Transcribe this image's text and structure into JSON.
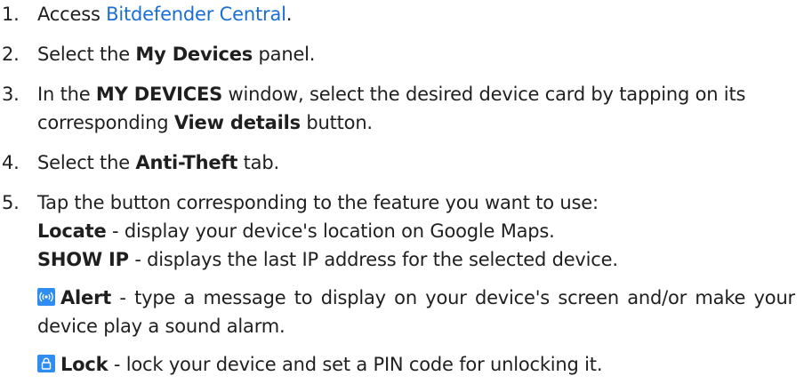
{
  "steps": [
    {
      "number": "1.",
      "prefix": "Access ",
      "link": "Bitdefender Central",
      "suffix": "."
    },
    {
      "number": "2.",
      "prefix": "Select the ",
      "bold": "My Devices",
      "suffix": " panel."
    },
    {
      "number": "3.",
      "prefix": "In the ",
      "bold1": "MY DEVICES",
      "mid": " window, select the desired device card by tapping on its corresponding ",
      "bold2": "View details",
      "suffix": " button."
    },
    {
      "number": "4.",
      "prefix": "Select the ",
      "bold": "Anti-Theft",
      "suffix": " tab."
    },
    {
      "number": "5.",
      "intro": "Tap the button corresponding to the feature you want to use:"
    }
  ],
  "features": [
    {
      "name": "Locate",
      "desc": " - display your device's location on Google Maps."
    },
    {
      "name": "SHOW IP",
      "desc": " - displays the last IP address for the selected device."
    },
    {
      "name": "Alert",
      "desc": " - type a message to display on your device's screen and/or make your device play a sound alarm.",
      "icon": "alert-sound-icon"
    },
    {
      "name": "Lock",
      "desc": " - lock your device and set a PIN code for unlocking it.",
      "icon": "lock-icon"
    }
  ],
  "colors": {
    "link": "#1a6fd6",
    "icon_bg": "#2f8cf0",
    "text": "#1f1f1f"
  }
}
